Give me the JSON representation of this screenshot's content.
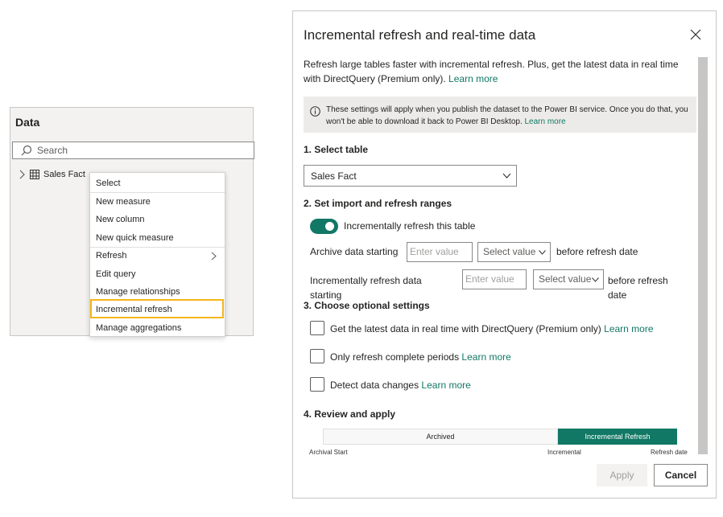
{
  "data_pane": {
    "title": "Data",
    "search_placeholder": "Search",
    "table_name": "Sales Fact"
  },
  "context_menu": {
    "items": [
      {
        "label": "Select"
      },
      {
        "label": "New measure"
      },
      {
        "label": "New column"
      },
      {
        "label": "New quick measure"
      },
      {
        "label": "Refresh",
        "has_submenu": true
      },
      {
        "label": "Edit query"
      },
      {
        "label": "Manage relationships"
      },
      {
        "label": "Incremental refresh",
        "highlighted": true
      },
      {
        "label": "Manage aggregations"
      }
    ],
    "highlight_color": "#f5b51b"
  },
  "dialog": {
    "title": "Incremental refresh and real-time data",
    "intro_text": "Refresh large tables faster with incremental refresh. Plus, get the latest data in real time with DirectQuery (Premium only).",
    "learn_more": "Learn more",
    "info_text": "These settings will apply when you publish the dataset to the Power BI service. Once you do that, you won't be able to download it back to Power BI Desktop.",
    "section1_label": "1. Select table",
    "selected_table": "Sales Fact",
    "section2_label": "2. Set import and refresh ranges",
    "toggle_label": "Incrementally refresh this table",
    "toggle_on": true,
    "archive_label": "Archive data starting",
    "archive_placeholder": "Enter value",
    "archive_select": "Select value",
    "archive_suffix": "before refresh date",
    "incremental_label": "Incrementally refresh data starting",
    "incremental_placeholder": "Enter value",
    "incremental_select": "Select value",
    "incremental_suffix": "before refresh date",
    "section3_label": "3. Choose optional settings",
    "option_directquery": "Get the latest data in real time with DirectQuery (Premium only)",
    "option_complete_periods": "Only refresh complete periods",
    "option_detect_changes": "Detect data changes",
    "section4_label": "4. Review and apply",
    "timeline_archived": "Archived",
    "timeline_incremental": "Incremental Refresh",
    "tick_archival_start": "Archival Start",
    "tick_incremental": "Incremental",
    "tick_refresh_date": "Refresh date",
    "apply_label": "Apply",
    "cancel_label": "Cancel",
    "accent_color": "#117865"
  }
}
